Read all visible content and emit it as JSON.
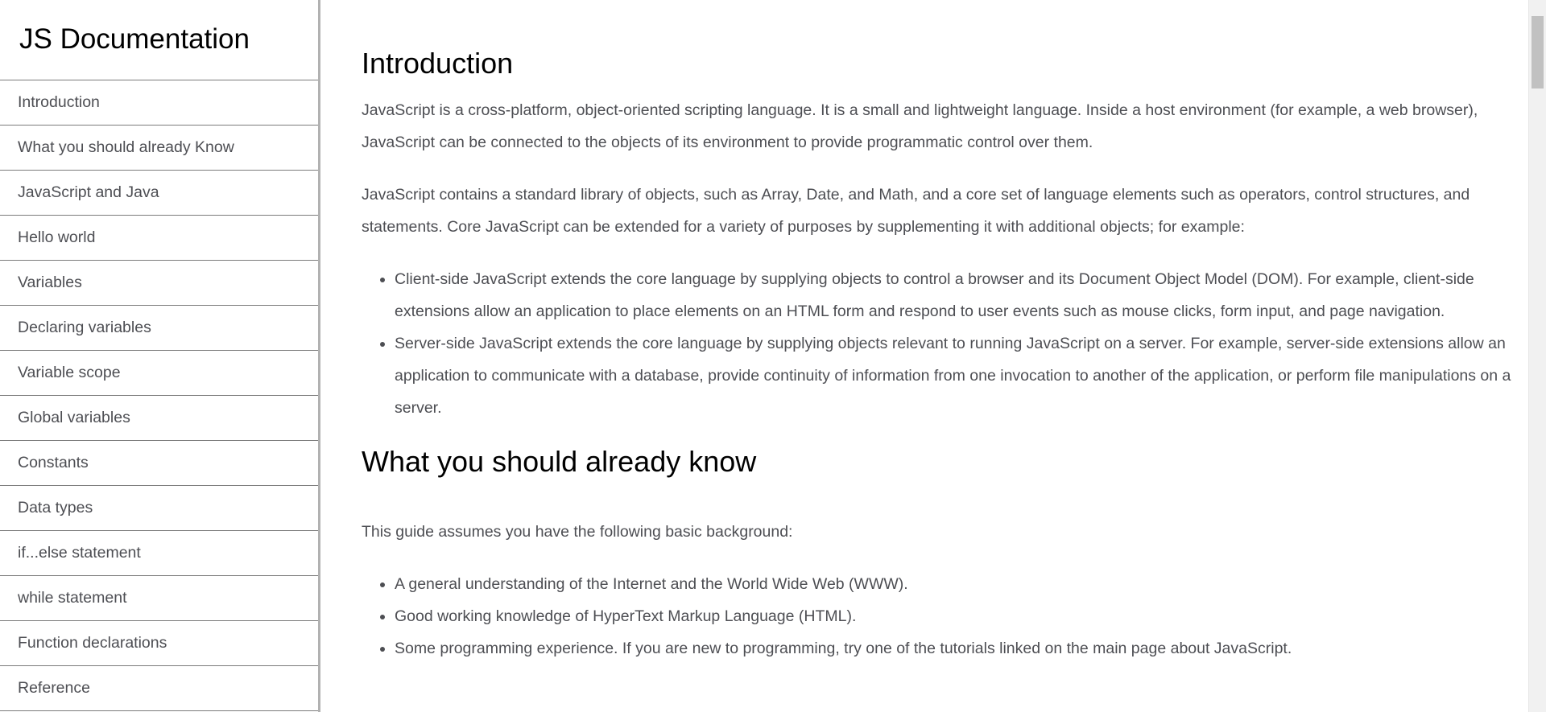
{
  "navbar": {
    "title": "JS Documentation",
    "items": [
      "Introduction",
      "What you should already Know",
      "JavaScript and Java",
      "Hello world",
      "Variables",
      "Declaring variables",
      "Variable scope",
      "Global variables",
      "Constants",
      "Data types",
      "if...else statement",
      "while statement",
      "Function declarations",
      "Reference"
    ]
  },
  "main": {
    "intro": {
      "heading": "Introduction",
      "p1": "JavaScript is a cross-platform, object-oriented scripting language. It is a small and lightweight language. Inside a host environment (for example, a web browser), JavaScript can be connected to the objects of its environment to provide programmatic control over them.",
      "p2": "JavaScript contains a standard library of objects, such as Array, Date, and Math, and a core set of language elements such as operators, control structures, and statements. Core JavaScript can be extended for a variety of purposes by supplementing it with additional objects; for example:",
      "bullets": [
        "Client-side JavaScript extends the core language by supplying objects to control a browser and its Document Object Model (DOM). For example, client-side extensions allow an application to place elements on an HTML form and respond to user events such as mouse clicks, form input, and page navigation.",
        "Server-side JavaScript extends the core language by supplying objects relevant to running JavaScript on a server. For example, server-side extensions allow an application to communicate with a database, provide continuity of information from one invocation to another of the application, or perform file manipulations on a server."
      ]
    },
    "know": {
      "heading": "What you should already know",
      "p1": "This guide assumes you have the following basic background:",
      "bullets": [
        "A general understanding of the Internet and the World Wide Web (WWW).",
        "Good working knowledge of HyperText Markup Language (HTML).",
        "Some programming experience. If you are new to programming, try one of the tutorials linked on the main page about JavaScript."
      ]
    }
  },
  "colors": {
    "text": "#4d4e53",
    "heading": "#000000",
    "divider": "#7b7b7b",
    "sidebar_border": "#b1b1b1"
  }
}
